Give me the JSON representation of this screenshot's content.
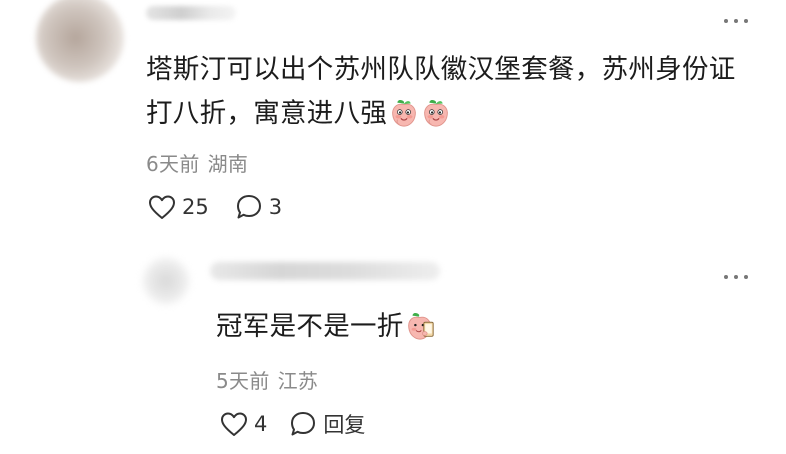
{
  "comment": {
    "text": "塔斯汀可以出个苏州队队徽汉堡套餐，苏州身份证打八折，寓意进八强",
    "emojis": [
      "peach-face-emoji",
      "peach-face-emoji"
    ],
    "time": "6天前",
    "location": "湖南",
    "likes": "25",
    "replies": "3"
  },
  "reply": {
    "text": "冠军是不是一折",
    "emoji": "peach-face-phone-emoji",
    "time": "5天前",
    "location": "江苏",
    "likes": "4",
    "reply_label": "回复"
  },
  "icons": {
    "more": "more-dots-icon",
    "like": "heart-outline-icon",
    "comment": "speech-bubble-icon"
  },
  "colors": {
    "text": "#1c1c1c",
    "meta": "#8a8a8a",
    "emoji_peach": "#f5b3ae"
  }
}
